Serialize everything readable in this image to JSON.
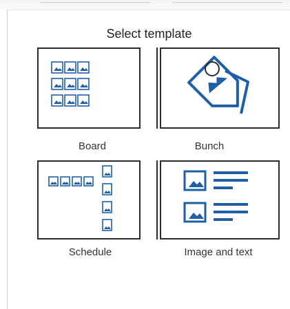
{
  "dialog": {
    "title": "Select template"
  },
  "templates": [
    {
      "id": "board",
      "label": "Board",
      "icon": "image-grid-icon"
    },
    {
      "id": "bunch",
      "label": "Bunch",
      "icon": "tag-bunch-icon"
    },
    {
      "id": "schedule",
      "label": "Schedule",
      "icon": "image-schedule-icon"
    },
    {
      "id": "image_and_text",
      "label": "Image and text",
      "icon": "image-and-text-icon"
    }
  ],
  "colors": {
    "icon_blue": "#1e5fa8",
    "border": "#2b2b2b"
  }
}
